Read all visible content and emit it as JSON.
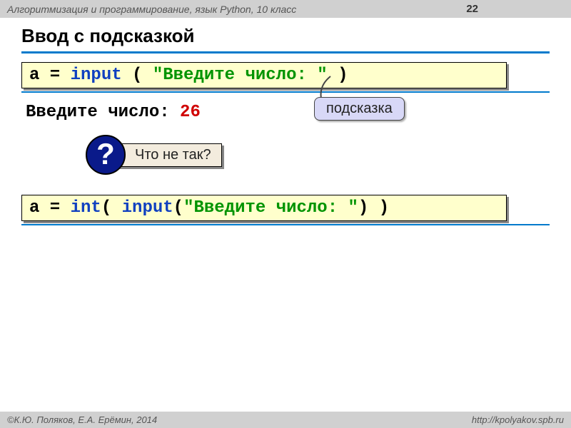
{
  "header": {
    "title": "Алгоритмизация и программирование, язык Python, 10 класс",
    "page": "22"
  },
  "slide": {
    "title": "Ввод с подсказкой"
  },
  "code1": {
    "p1": "a = ",
    "func": "input",
    "p2": " ( ",
    "str": "\"Введите число: \"",
    "p3": " )"
  },
  "output": {
    "prompt": "Введите число: ",
    "value": "26"
  },
  "hint": {
    "label": "подсказка"
  },
  "question": {
    "mark": "?",
    "text": "Что не так?"
  },
  "code2": {
    "p1": "a = ",
    "func1": "int",
    "p2": "( ",
    "func2": "input",
    "p3": "(",
    "str": "\"Введите число: \"",
    "p4": ") )"
  },
  "footer": {
    "left": "©К.Ю. Поляков, Е.А. Ерёмин, 2014",
    "right": "http://kpolyakov.spb.ru"
  }
}
